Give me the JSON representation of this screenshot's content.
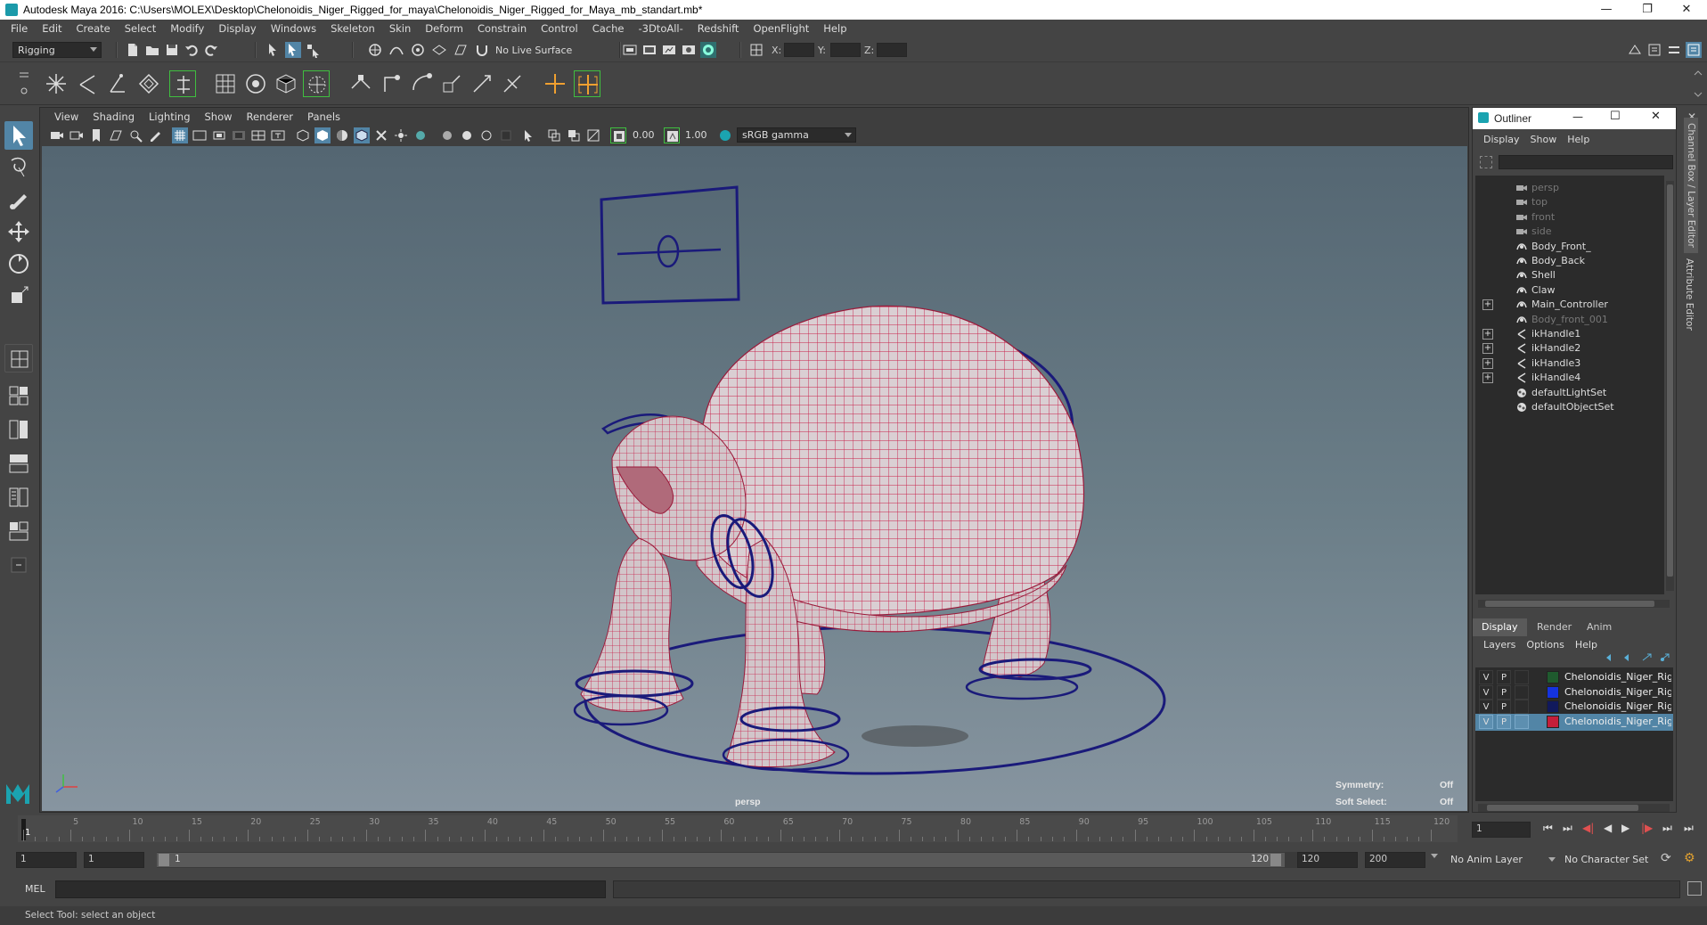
{
  "window": {
    "title": "Autodesk Maya 2016: C:\\Users\\MOLEX\\Desktop\\Chelonoidis_Niger_Rigged_for_maya\\Chelonoidis_Niger_Rigged_for_Maya_mb_standart.mb*",
    "minimize": "—",
    "restore": "❐",
    "close": "✕"
  },
  "menubar": [
    "File",
    "Edit",
    "Create",
    "Select",
    "Modify",
    "Display",
    "Windows",
    "Skeleton",
    "Skin",
    "Deform",
    "Constrain",
    "Control",
    "Cache",
    "-3DtoAll-",
    "Redshift",
    "OpenFlight",
    "Help"
  ],
  "statusline": {
    "menuset": "Rigging",
    "live_surface": "No Live Surface",
    "x_label": "X:",
    "y_label": "Y:",
    "z_label": "Z:"
  },
  "viewport": {
    "menu": [
      "View",
      "Shading",
      "Lighting",
      "Show",
      "Renderer",
      "Panels"
    ],
    "near_value": "0.00",
    "far_value": "1.00",
    "color_space": "sRGB gamma",
    "camera_label": "persp",
    "hud": {
      "symmetry_label": "Symmetry:",
      "symmetry_value": "Off",
      "soft_select_label": "Soft Select:",
      "soft_select_value": "Off"
    }
  },
  "outliner": {
    "title": "Outliner",
    "menu": [
      "Display",
      "Show",
      "Help"
    ],
    "items": [
      {
        "label": "persp",
        "type": "camera",
        "dim": true,
        "expandable": false
      },
      {
        "label": "top",
        "type": "camera",
        "dim": true,
        "expandable": false
      },
      {
        "label": "front",
        "type": "camera",
        "dim": true,
        "expandable": false
      },
      {
        "label": "side",
        "type": "camera",
        "dim": true,
        "expandable": false
      },
      {
        "label": "Body_Front_",
        "type": "curve",
        "dim": false,
        "expandable": false
      },
      {
        "label": "Body_Back",
        "type": "curve",
        "dim": false,
        "expandable": false
      },
      {
        "label": "Shell",
        "type": "curve",
        "dim": false,
        "expandable": false
      },
      {
        "label": "Claw",
        "type": "curve",
        "dim": false,
        "expandable": false
      },
      {
        "label": "Main_Controller",
        "type": "curve",
        "dim": false,
        "expandable": true
      },
      {
        "label": "Body_front_001",
        "type": "curve",
        "dim": true,
        "expandable": false
      },
      {
        "label": "ikHandle1",
        "type": "ik",
        "dim": false,
        "expandable": true
      },
      {
        "label": "ikHandle2",
        "type": "ik",
        "dim": false,
        "expandable": true
      },
      {
        "label": "ikHandle3",
        "type": "ik",
        "dim": false,
        "expandable": true
      },
      {
        "label": "ikHandle4",
        "type": "ik",
        "dim": false,
        "expandable": true
      },
      {
        "label": "defaultLightSet",
        "type": "set",
        "dim": false,
        "expandable": false
      },
      {
        "label": "defaultObjectSet",
        "type": "set",
        "dim": false,
        "expandable": false
      }
    ]
  },
  "layer_editor": {
    "tabs": [
      "Display",
      "Render",
      "Anim"
    ],
    "active_tab": "Display",
    "menu": [
      "Layers",
      "Options",
      "Help"
    ],
    "layers": [
      {
        "v": "V",
        "p": "P",
        "color": "#1f5a2e",
        "name": "Chelonoidis_Niger_Rigged_",
        "selected": false
      },
      {
        "v": "V",
        "p": "P",
        "color": "#1533e0",
        "name": "Chelonoidis_Niger_Rigged_",
        "selected": false
      },
      {
        "v": "V",
        "p": "P",
        "color": "#11195c",
        "name": "Chelonoidis_Niger_Rigged_",
        "selected": false
      },
      {
        "v": "V",
        "p": "P",
        "color": "#c41e3a",
        "name": "Chelonoidis_Niger_Rigged_",
        "selected": true
      }
    ]
  },
  "side_tabs": [
    "Channel Box / Layer Editor",
    "Attribute Editor"
  ],
  "timeline": {
    "ticks": [
      "1",
      "5",
      "10",
      "15",
      "20",
      "25",
      "30",
      "35",
      "40",
      "45",
      "50",
      "55",
      "60",
      "65",
      "70",
      "75",
      "80",
      "85",
      "90",
      "95",
      "100",
      "105",
      "110",
      "115",
      "120"
    ],
    "current_frame": "1"
  },
  "range": {
    "start": "1",
    "playback_start": "1",
    "slider_start": "1",
    "slider_end": "120",
    "playback_end": "120",
    "end": "200",
    "anim_layer": "No Anim Layer",
    "character_set": "No Character Set"
  },
  "cmdline": {
    "label": "MEL"
  },
  "helpline": {
    "text": "Select Tool: select an object"
  },
  "colors": {
    "rig_curve": "#1a1a7a",
    "wireframe": "#c8204a",
    "mesh": "#d9cfd2",
    "accent_green": "#3fbf3f",
    "selection_blue": "#5285a6"
  }
}
